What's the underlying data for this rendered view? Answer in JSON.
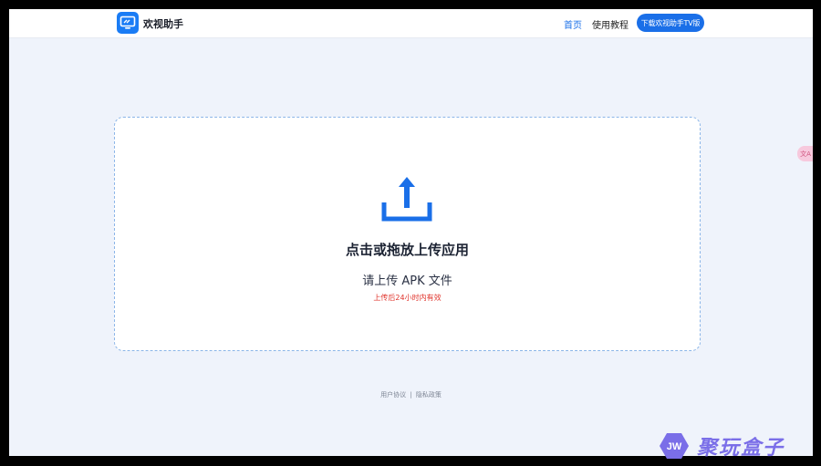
{
  "header": {
    "brand": "欢视助手",
    "nav_home": "首页",
    "nav_tutorial": "使用教程",
    "download_button": "下载欢视助手TV版",
    "logo_icon": "screen-icon",
    "accent_color": "#1a6fe8"
  },
  "upload": {
    "icon": "upload-arrow-icon",
    "title": "点击或拖放上传应用",
    "subtitle": "请上传 APK 文件",
    "note": "上传后24小时内有效"
  },
  "footer": {
    "user_agreement": "用户协议",
    "separator": "|",
    "privacy_policy": "隐私政策"
  },
  "side_tab": {
    "label": "文A",
    "icon": "translate-icon"
  },
  "watermark": {
    "badge": "JW",
    "text": "聚玩盒子"
  }
}
